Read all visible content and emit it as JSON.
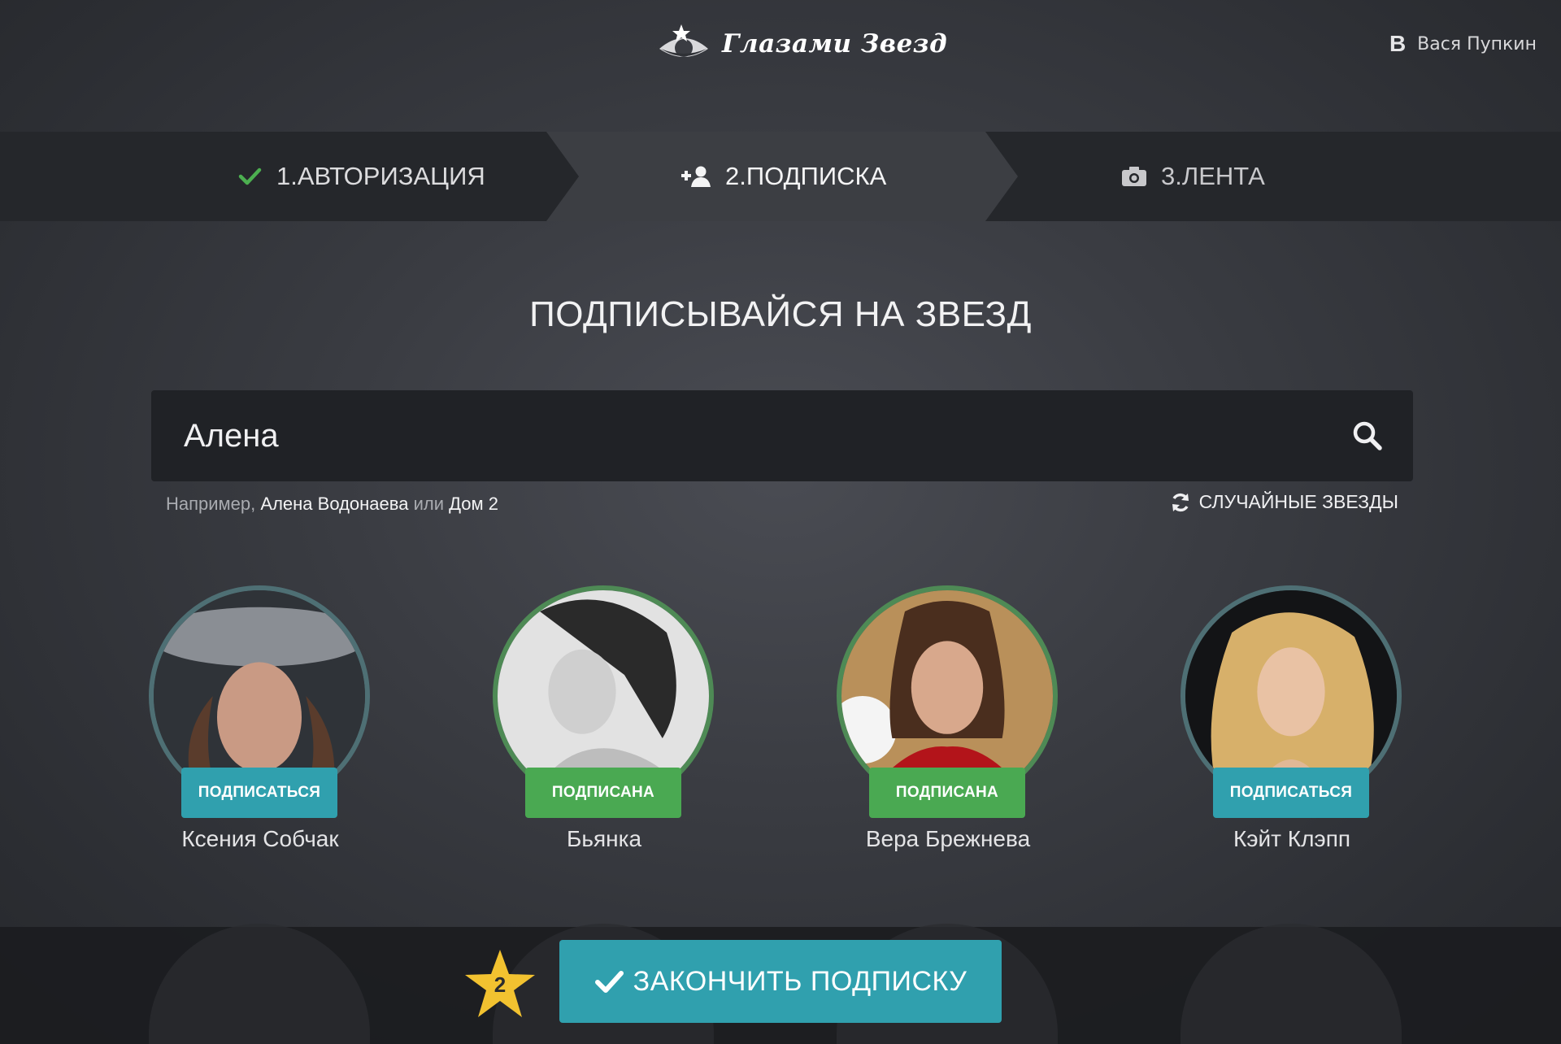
{
  "header": {
    "logo_text": "Глазами Звезд",
    "logo_icon": "eye-star-icon",
    "user_name": "Вася Пупкин",
    "vk_label": "В"
  },
  "steps": [
    {
      "label": "1.АВТОРИЗАЦИЯ",
      "icon": "check-icon",
      "state": "done"
    },
    {
      "label": "2.ПОДПИСКА",
      "icon": "add-user-icon",
      "state": "active"
    },
    {
      "label": "3.ЛЕНТА",
      "icon": "camera-icon",
      "state": "pending"
    }
  ],
  "main": {
    "title": "ПОДПИСЫВАЙСЯ НА ЗВЕЗД",
    "search": {
      "value": "Алена",
      "placeholder": ""
    },
    "hint": {
      "prefix": "Например,",
      "example1": "Алена Водонаева",
      "or": "или",
      "example2": "Дом 2"
    },
    "random_label": "СЛУЧАЙНЫЕ ЗВЕЗДЫ"
  },
  "celebrities": [
    {
      "name": "Ксения Собчак",
      "button": "ПОДПИСАТЬСЯ",
      "subscribed": false
    },
    {
      "name": "Бьянка",
      "button": "ПОДПИСАНА",
      "subscribed": true
    },
    {
      "name": "Вера Брежнева",
      "button": "ПОДПИСАНА",
      "subscribed": true
    },
    {
      "name": "Кэйт Клэпп",
      "button": "ПОДПИСАТЬСЯ",
      "subscribed": false
    }
  ],
  "footer": {
    "star_count": "2",
    "finish_label": "ЗАКОНЧИТЬ ПОДПИСКУ"
  },
  "colors": {
    "accent_teal": "#30a0ae",
    "subscribed_green": "#4aa952",
    "check_green": "#4caf50",
    "star_gold": "#f2c230"
  }
}
